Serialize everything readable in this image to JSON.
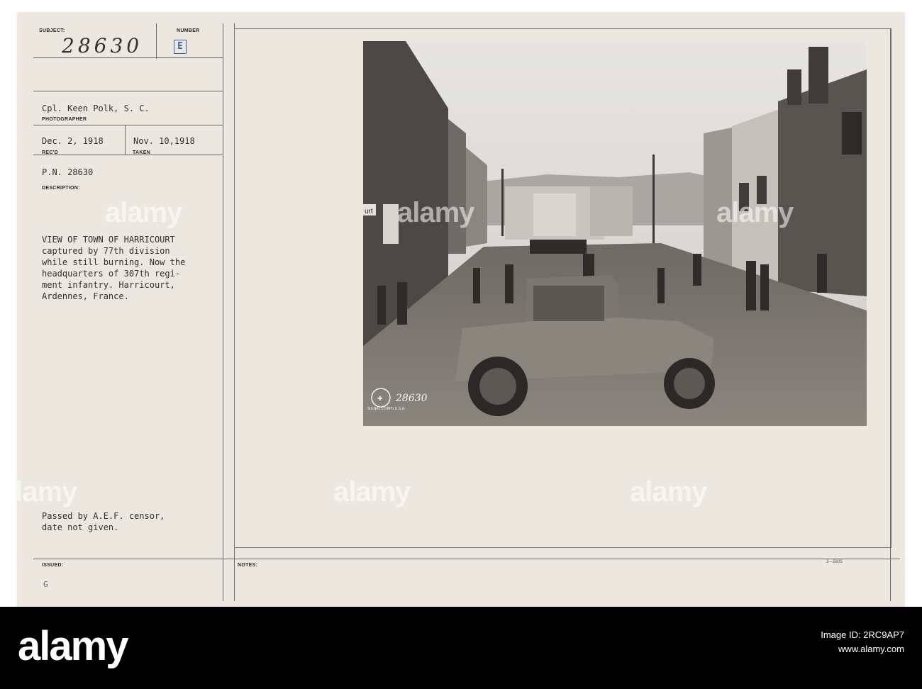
{
  "card": {
    "labels": {
      "subject": "SUBJECT:",
      "number": "NUMBER",
      "photographer": "PHOTOGRAPHER",
      "recd": "REC'D",
      "taken": "TAKEN",
      "description": "DESCRIPTION:",
      "issued": "ISSUED:",
      "notes": "NOTES:"
    },
    "subject_number_handwritten": "28630",
    "number_stamp": "E",
    "photographer": "Cpl. Keen Polk, S. C.",
    "received_date": "Dec. 2, 1918",
    "taken_date": "Nov. 10,1918",
    "pn": "P.N. 28630",
    "description_lines": [
      "VIEW OF TOWN OF HARRICOURT",
      "captured by 77th division",
      "while still burning. Now the",
      "headquarters of 307th regi-",
      "ment infantry. Harricourt,",
      "Ardennes, France."
    ],
    "censor_lines": [
      "Passed by A.E.F. censor,",
      "date not given."
    ],
    "issued_value": "G",
    "form_code": "3—5605"
  },
  "photo": {
    "sign_text": "urt",
    "plate_number": "28630",
    "stamp_text": "SIGNAL CORPS U.S.A."
  },
  "watermark": {
    "text": "alamy"
  },
  "stamp_bar": {
    "logo": "alamy",
    "image_id_label": "Image ID: 2RC9AP7",
    "site": "www.alamy.com"
  }
}
